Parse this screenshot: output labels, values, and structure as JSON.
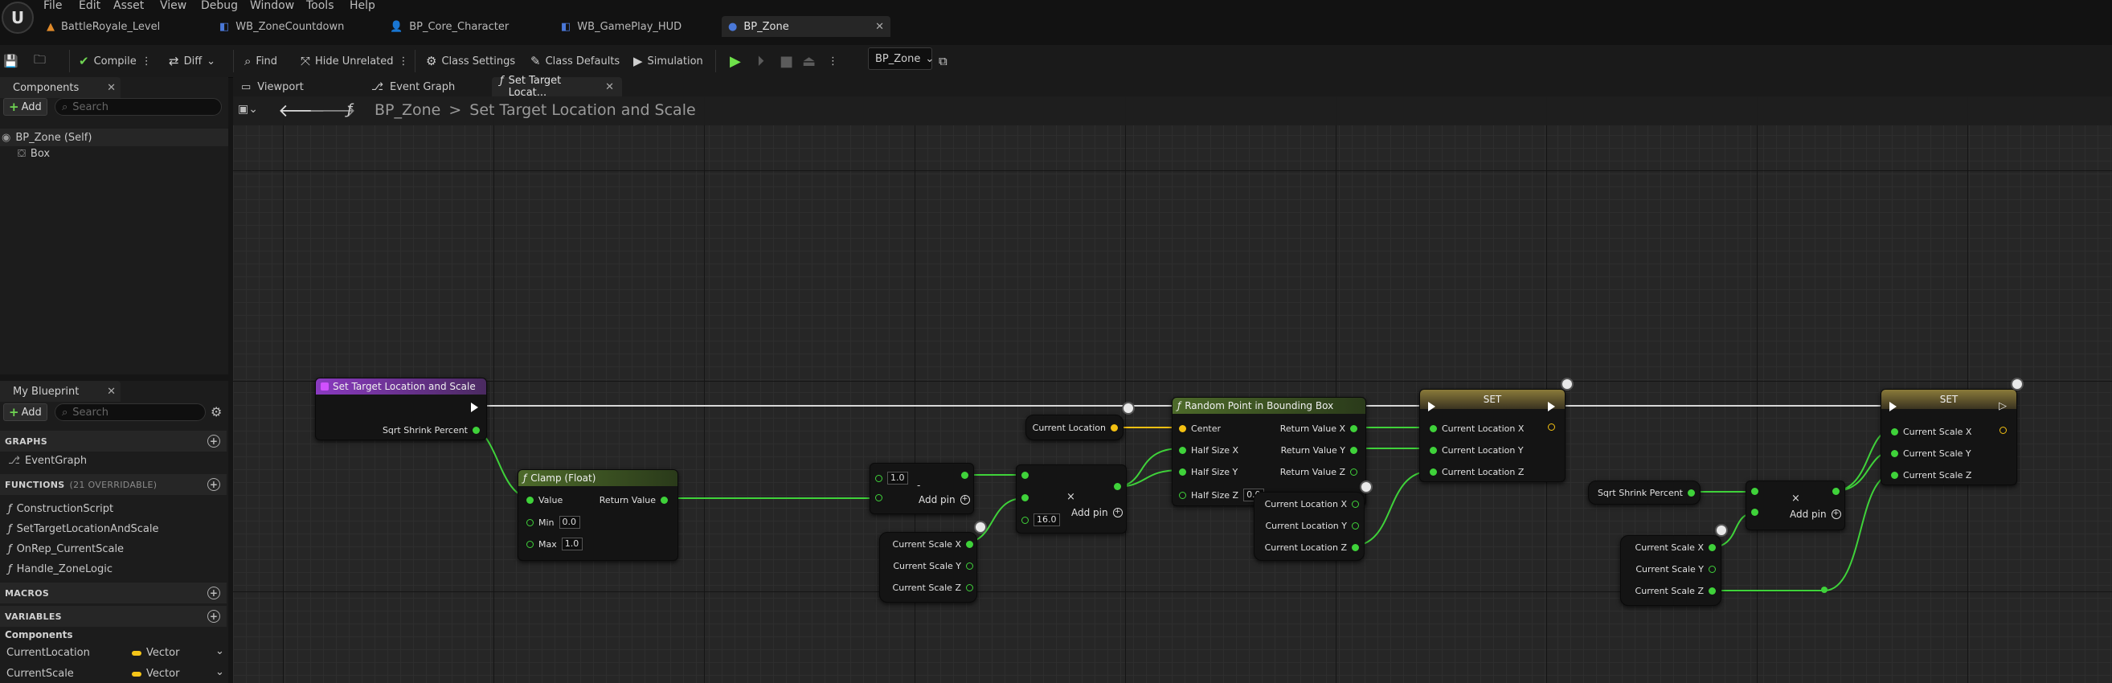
{
  "menu": [
    "File",
    "Edit",
    "Asset",
    "View",
    "Debug",
    "Window",
    "Tools",
    "Help"
  ],
  "doc_tabs": [
    "BattleRoyale_Level",
    "WB_ZoneCountdown",
    "BP_Core_Character",
    "WB_GamePlay_HUD",
    "BP_Zone"
  ],
  "toolbar": {
    "compile": "Compile",
    "diff": "Diff",
    "find": "Find",
    "hide_unrelated": "Hide Unrelated",
    "class_settings": "Class Settings",
    "class_defaults": "Class Defaults",
    "simulation": "Simulation",
    "debug_object": "BP_Zone"
  },
  "components_panel": {
    "title": "Components",
    "add": "Add",
    "search_placeholder": "Search",
    "items": [
      "BP_Zone (Self)",
      "Box"
    ]
  },
  "my_blueprint": {
    "title": "My Blueprint",
    "add": "Add",
    "search_placeholder": "Search",
    "graphs_header": "GRAPHS",
    "graphs": [
      "EventGraph"
    ],
    "functions_header": "FUNCTIONS",
    "functions_count": "(21 OVERRIDABLE)",
    "functions": [
      "ConstructionScript",
      "SetTargetLocationAndScale",
      "OnRep_CurrentScale",
      "Handle_ZoneLogic"
    ],
    "macros_header": "MACROS",
    "variables_header": "VARIABLES",
    "components_header": "Components",
    "variables": [
      {
        "name": "CurrentLocation",
        "type": "Vector"
      },
      {
        "name": "CurrentScale",
        "type": "Vector"
      }
    ]
  },
  "graph_tabs": [
    "Viewport",
    "Event Graph",
    "Set Target Locat..."
  ],
  "breadcrumb": {
    "root": "BP_Zone",
    "separator": ">",
    "current": "Set Target Location and Scale"
  },
  "nodes": {
    "entry": {
      "title": "Set Target Location and Scale",
      "pin": "Sqrt Shrink Percent"
    },
    "clamp": {
      "title": "Clamp (Float)",
      "value": "Value",
      "min": "Min",
      "min_val": "0.0",
      "max": "Max",
      "max_val": "1.0",
      "ret": "Return Value"
    },
    "subtract": {
      "input": "1.0",
      "op": "-",
      "addpin": "Add pin"
    },
    "multiply": {
      "op": "×",
      "input": "16.0",
      "addpin": "Add pin"
    },
    "scale_break1": {
      "x": "Current Scale X",
      "y": "Current Scale Y",
      "z": "Current Scale Z"
    },
    "current_location": "Current Location",
    "random_point": {
      "title": "Random Point in Bounding Box",
      "center": "Center",
      "hx": "Half Size X",
      "hy": "Half Size Y",
      "hz": "Half Size Z",
      "hz_val": "0.0",
      "rx": "Return Value X",
      "ry": "Return Value Y",
      "rz": "Return Value Z"
    },
    "loc_break": {
      "x": "Current Location X",
      "y": "Current Location Y",
      "z": "Current Location Z"
    },
    "set1": {
      "title": "SET",
      "x": "Current Location X",
      "y": "Current Location Y",
      "z": "Current Location Z"
    },
    "sqrt_var": "Sqrt Shrink Percent",
    "multiply2": {
      "op": "×",
      "addpin": "Add pin"
    },
    "scale_break2": {
      "x": "Current Scale X",
      "y": "Current Scale Y",
      "z": "Current Scale Z"
    },
    "set2": {
      "title": "SET",
      "x": "Current Scale X",
      "y": "Current Scale Y",
      "z": "Current Scale Z"
    }
  },
  "colors": {
    "wire_exec": "#d8d8d8",
    "wire_float": "#3fd23a",
    "wire_vector": "#f3c012",
    "func_header": "#6b8a3a",
    "event_header": "#7a3a9c"
  }
}
